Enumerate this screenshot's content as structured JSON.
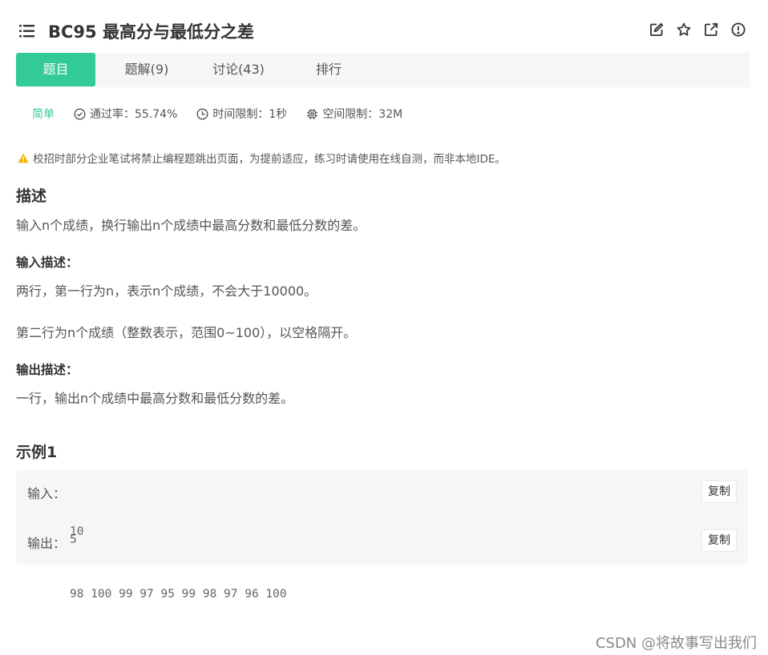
{
  "header": {
    "title": "BC95  最高分与最低分之差",
    "tools": [
      "edit-icon",
      "star-icon",
      "external-link-icon",
      "info-icon"
    ]
  },
  "tabs": [
    {
      "label": "题目",
      "active": true
    },
    {
      "label": "题解(9)",
      "active": false
    },
    {
      "label": "讨论(43)",
      "active": false
    },
    {
      "label": "排行",
      "active": false
    }
  ],
  "meta": {
    "difficulty": "简单",
    "pass_rate": "通过率：55.74%",
    "time_limit": "时间限制：1秒",
    "space_limit": "空间限制：32M"
  },
  "notice": "校招时部分企业笔试将禁止编程题跳出页面，为提前适应，练习时请使用在线自测，而非本地IDE。",
  "description": {
    "heading": "描述",
    "text": "输入n个成绩，换行输出n个成绩中最高分数和最低分数的差。"
  },
  "input_desc": {
    "heading": "输入描述：",
    "line1": "两行，第一行为n，表示n个成绩，不会大于10000。",
    "line2": "第二行为n个成绩（整数表示，范围0~100），以空格隔开。"
  },
  "output_desc": {
    "heading": "输出描述：",
    "text": "一行，输出n个成绩中最高分数和最低分数的差。"
  },
  "example": {
    "heading": "示例1",
    "input_label": "输入：",
    "input_line1": "10",
    "input_line2": "98 100 99 97 95 99 98 97 96 100",
    "output_label": "输出：",
    "output_value": "5",
    "copy_label": "复制"
  },
  "watermark": "CSDN @将故事写出我们",
  "colors": {
    "accent": "#32ca99",
    "warning": "#f5b400",
    "tab_bg": "#f5f6f8"
  }
}
